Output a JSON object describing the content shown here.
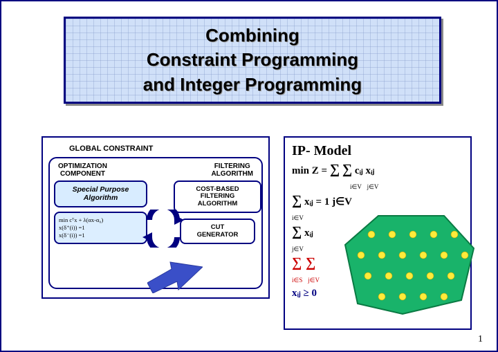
{
  "title": {
    "line1": "Combining",
    "line2": "Constraint Programming",
    "line3": "and Integer Programming"
  },
  "left": {
    "global_constraint": "GLOBAL CONSTRAINT",
    "optimization": "OPTIMIZATION",
    "component": "COMPONENT",
    "filtering": "FILTERING",
    "algorithm": "ALGORITHM",
    "special_purpose": "Special Purpose",
    "special_algorithm": "Algorithm",
    "math_line1": "min cᵀx + λ(αx-α₀)",
    "math_line2": "x(δ⁺(i)) =1",
    "math_line3": "x(δ⁻(i)) =1",
    "cost_based": "COST-BASED",
    "cb_filtering": "FILTERING",
    "cb_algorithm": "ALGORITHM",
    "cut": "CUT",
    "generator": "GENERATOR"
  },
  "right": {
    "heading": "IP- Model",
    "min_z": "min Z = ",
    "sigma": "∑",
    "sub_iv": "i∈V",
    "sub_jv": "j∈V",
    "cij": " cᵢⱼ xᵢⱼ",
    "eq1_xij": " xᵢⱼ = 1   j∈V",
    "eq2_xij": " xᵢⱼ",
    "sub_is": "i∈S",
    "sub_jvs": "j∈V",
    "bound": "xᵢⱼ ≥ 0"
  },
  "footer": {
    "page": "1"
  }
}
